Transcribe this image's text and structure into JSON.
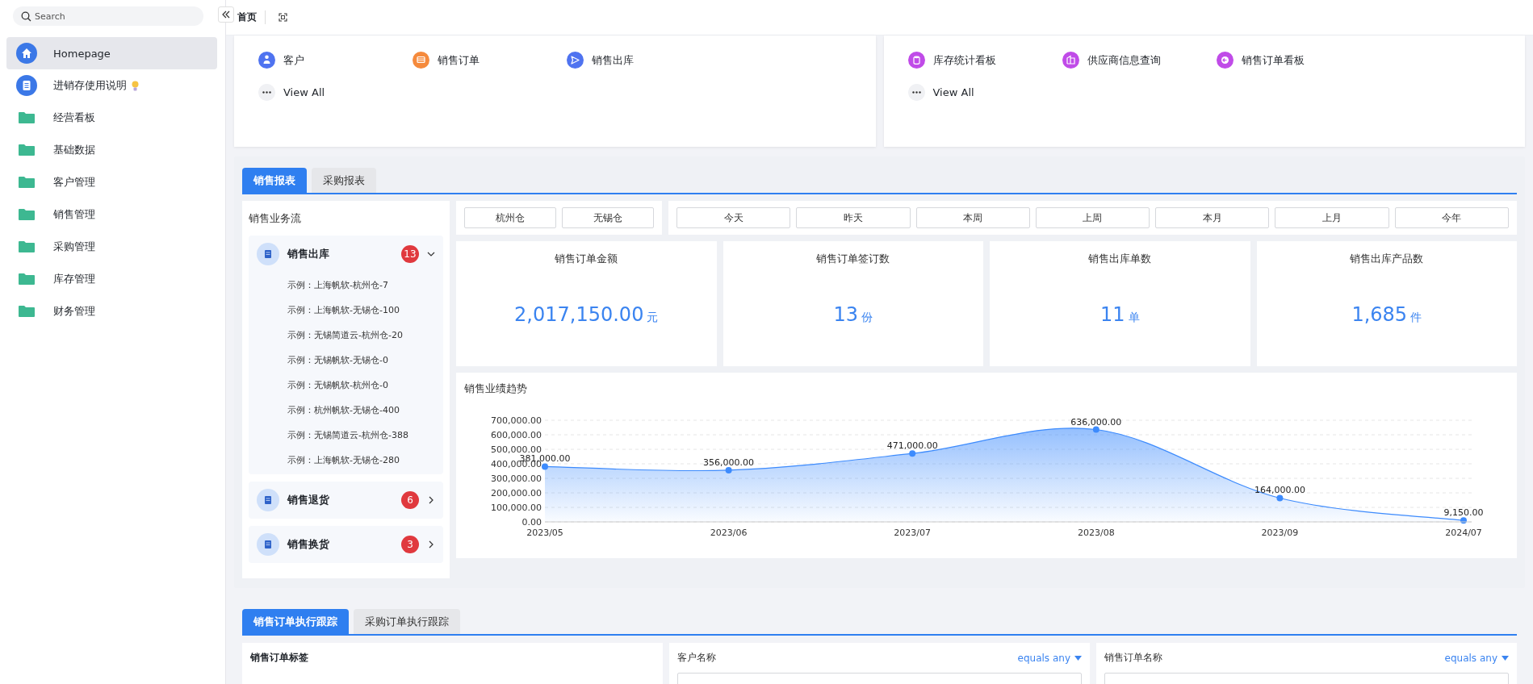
{
  "sidebar": {
    "search": {
      "placeholder": "Search"
    },
    "items": [
      {
        "label": "Homepage",
        "kind": "home",
        "selected": true,
        "hint_icon": false
      },
      {
        "label": "进销存使用说明",
        "kind": "doc",
        "selected": false,
        "hint_icon": true
      },
      {
        "label": "经营看板",
        "kind": "folder",
        "selected": false,
        "hint_icon": false
      },
      {
        "label": "基础数据",
        "kind": "folder",
        "selected": false,
        "hint_icon": false
      },
      {
        "label": "客户管理",
        "kind": "folder",
        "selected": false,
        "hint_icon": false
      },
      {
        "label": "销售管理",
        "kind": "folder",
        "selected": false,
        "hint_icon": false
      },
      {
        "label": "采购管理",
        "kind": "folder",
        "selected": false,
        "hint_icon": false
      },
      {
        "label": "库存管理",
        "kind": "folder",
        "selected": false,
        "hint_icon": false
      },
      {
        "label": "财务管理",
        "kind": "folder",
        "selected": false,
        "hint_icon": false
      }
    ]
  },
  "topbar": {
    "page_title": "首页"
  },
  "shortcuts": [
    {
      "items": [
        {
          "label": "客户",
          "kind": "person",
          "color": "#4f73f0"
        },
        {
          "label": "销售订单",
          "kind": "table",
          "color": "#f58a3c"
        },
        {
          "label": "销售出库",
          "kind": "send",
          "color": "#4f73f0"
        }
      ],
      "view_all": "View All"
    },
    {
      "items": [
        {
          "label": "库存统计看板",
          "kind": "database",
          "color": "#c04be8"
        },
        {
          "label": "供应商信息查询",
          "kind": "building",
          "color": "#c04be8"
        },
        {
          "label": "销售订单看板",
          "kind": "arrow",
          "color": "#c04be8"
        }
      ],
      "view_all": "View All"
    }
  ],
  "report": {
    "tabs": [
      {
        "label": "销售报表",
        "selected": true
      },
      {
        "label": "采购报表",
        "selected": false
      }
    ],
    "flow": {
      "title": "销售业务流",
      "groups": [
        {
          "label": "销售出库",
          "count": "13",
          "expanded": true,
          "children": [
            "示例：上海帆软-杭州仓-7",
            "示例：上海帆软-无锡仓-100",
            "示例：无锡简道云-杭州仓-20",
            "示例：无锡帆软-无锡仓-0",
            "示例：无锡帆软-杭州仓-0",
            "示例：杭州帆软-无锡仓-400",
            "示例：无锡简道云-杭州仓-388",
            "示例：上海帆软-无锡仓-280"
          ]
        },
        {
          "label": "销售退货",
          "count": "6",
          "expanded": false
        },
        {
          "label": "销售换货",
          "count": "3",
          "expanded": false
        }
      ]
    },
    "warehouses": [
      "杭州仓",
      "无锡仓"
    ],
    "periods": [
      "今天",
      "昨天",
      "本周",
      "上周",
      "本月",
      "上月",
      "今年"
    ],
    "stats": [
      {
        "label": "销售订单金额",
        "value": "2,017,150.00",
        "unit": "元"
      },
      {
        "label": "销售订单签订数",
        "value": "13",
        "unit": "份"
      },
      {
        "label": "销售出库单数",
        "value": "11",
        "unit": "单"
      },
      {
        "label": "销售出库产品数",
        "value": "1,685",
        "unit": "件"
      }
    ],
    "chart": {
      "title": "销售业绩趋势",
      "chart_data": {
        "type": "area",
        "categories": [
          "2023/05",
          "2023/06",
          "2023/07",
          "2023/08",
          "2023/09",
          "2024/07"
        ],
        "series": [
          {
            "color": "#3d8bfd",
            "values": [
              381000,
              356000,
              471000,
              636000,
              164000,
              9150
            ]
          }
        ],
        "value_labels": [
          "381,000.00",
          "356,000.00",
          "471,000.00",
          "636,000.00",
          "164,000.00",
          "9,150.00"
        ],
        "ylim": [
          0,
          700000
        ],
        "grid": true,
        "yticks": [
          {
            "value": 0,
            "label": "0.00"
          },
          {
            "value": 100000,
            "label": "100,000.00"
          },
          {
            "value": 200000,
            "label": "200,000.00"
          },
          {
            "value": 300000,
            "label": "300,000.00"
          },
          {
            "value": 400000,
            "label": "400,000.00"
          },
          {
            "value": 500000,
            "label": "500,000.00"
          },
          {
            "value": 600000,
            "label": "600,000.00"
          },
          {
            "value": 700000,
            "label": "700,000.00"
          }
        ]
      }
    }
  },
  "tracking": {
    "tabs": [
      {
        "label": "销售订单执行跟踪",
        "selected": true
      },
      {
        "label": "采购订单执行跟踪",
        "selected": false
      }
    ],
    "tags_title": "销售订单标签",
    "filters": [
      {
        "label": "客户名称",
        "operator": "equals any"
      },
      {
        "label": "销售订单名称",
        "operator": "equals any"
      }
    ]
  }
}
